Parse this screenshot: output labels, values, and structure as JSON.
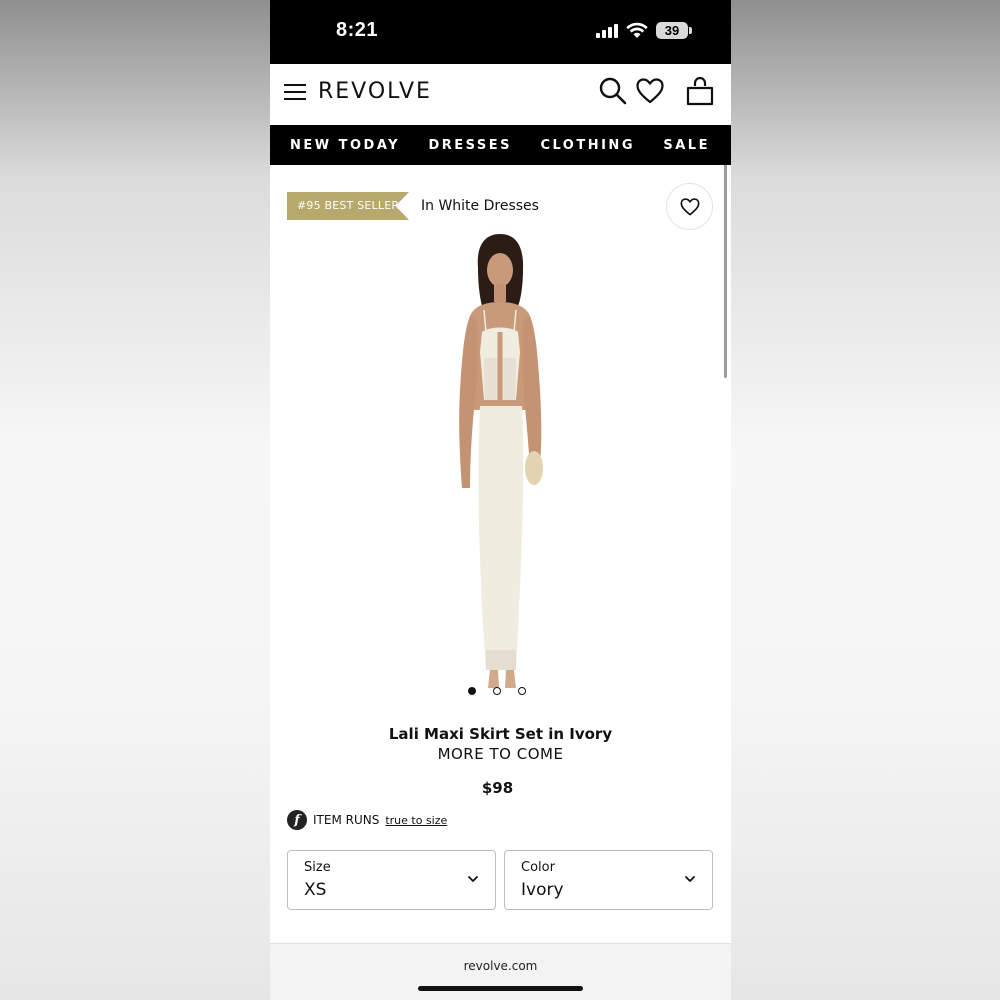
{
  "status_bar": {
    "time": "8:21",
    "battery": "39"
  },
  "header": {
    "brand": "REVOLVE",
    "icons": [
      "menu-icon",
      "search-icon",
      "heart-icon",
      "shopping-bag-icon"
    ]
  },
  "nav": {
    "items": [
      "NEW TODAY",
      "DRESSES",
      "CLOTHING",
      "SALE"
    ]
  },
  "badge": {
    "label": "#95 BEST SELLER",
    "category": "In White Dresses",
    "color": "#b7a86b"
  },
  "product": {
    "title": "Lali Maxi Skirt Set in Ivory",
    "subtitle": "MORE TO COME",
    "price": "$98",
    "image_count": 3,
    "active_image": 1
  },
  "fit": {
    "label": "ITEM RUNS",
    "value": "true to size"
  },
  "selectors": {
    "size": {
      "label": "Size",
      "value": "XS"
    },
    "color": {
      "label": "Color",
      "value": "Ivory"
    }
  },
  "browser": {
    "url": "revolve.com"
  }
}
